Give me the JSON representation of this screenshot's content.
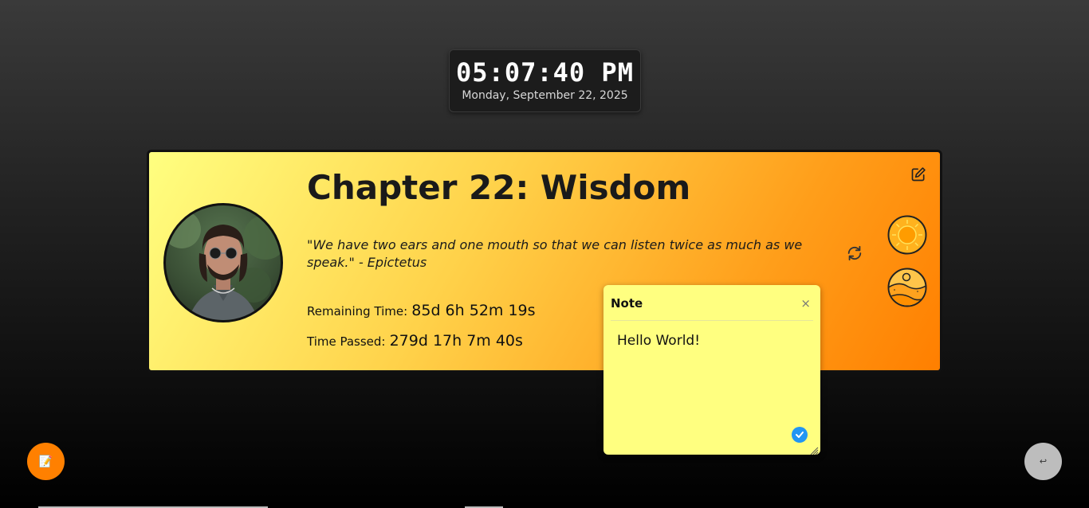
{
  "clock": {
    "time": "05:07:40 PM",
    "date": "Monday, September 22, 2025"
  },
  "card": {
    "title": "Chapter 22: Wisdom",
    "quote": "\"We have two ears and one mouth so that we can listen twice as much as we speak.\" - Epictetus",
    "remaining_label": "Remaining Time:",
    "remaining_value": "85d 6h 52m 19s",
    "passed_label": "Time Passed:",
    "passed_value": "279d 17h 7m 40s",
    "icons": {
      "avatar": "profile-photo",
      "edit": "edit-icon",
      "refresh": "refresh-icon",
      "theme_sun": "sun-icon",
      "theme_desert": "desert-icon"
    }
  },
  "note": {
    "title": "Note",
    "close_glyph": "×",
    "content": "Hello World!",
    "save_icon": "check-icon"
  },
  "fabs": {
    "note_icon": "note-icon",
    "note_glyph": "📝",
    "back_icon": "return-icon",
    "back_glyph": "↩"
  },
  "colors": {
    "accent": "#ff8000",
    "card_start": "#ffff80",
    "card_end": "#ff7f00",
    "note_bg": "#ffff80",
    "save_blue": "#2196f3"
  }
}
